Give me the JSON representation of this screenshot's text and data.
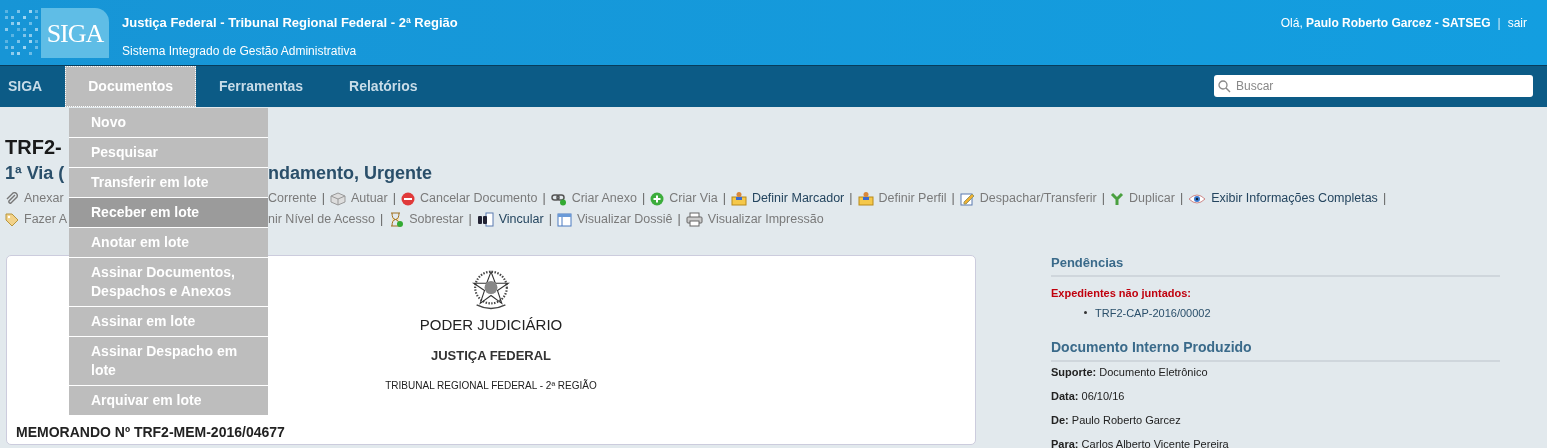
{
  "header": {
    "logo_text": "SIGA",
    "title": "Justiça Federal - Tribunal Regional Federal - 2ª Região",
    "subtitle": "Sistema Integrado de Gestão Administrativa",
    "greeting": "Olá,",
    "user": "Paulo Roberto Garcez - SATSEG",
    "separator": "|",
    "logout": "sair"
  },
  "nav": {
    "items": [
      {
        "label": "SIGA",
        "selected": false
      },
      {
        "label": "Documentos",
        "selected": true
      },
      {
        "label": "Ferramentas",
        "selected": false
      },
      {
        "label": "Relatórios",
        "selected": false
      }
    ],
    "search": {
      "placeholder": "Buscar"
    }
  },
  "menu": [
    {
      "label": "Novo",
      "selected": false
    },
    {
      "label": "Pesquisar",
      "selected": false
    },
    {
      "label": "Transferir em lote",
      "selected": false
    },
    {
      "label": "Receber em lote",
      "selected": true
    },
    {
      "label": "Anotar em lote",
      "selected": false
    },
    {
      "label": "Assinar Documentos, Despachos e Anexos",
      "selected": false
    },
    {
      "label": "Assinar em lote",
      "selected": false
    },
    {
      "label": "Assinar Despacho em lote",
      "selected": false
    },
    {
      "label": "Arquivar em lote",
      "selected": false
    }
  ],
  "document": {
    "heading": "TRF2-",
    "subtitle_left": "1ª Via (",
    "subtitle_right": "ndamento, Urgente",
    "action_rows": [
      {
        "left": {
          "label": "Anexar",
          "kind": "clip",
          "disabled": true
        },
        "items": [
          {
            "label": "Corrente",
            "kind": "none",
            "disabled": true,
            "separator": "|"
          },
          {
            "label": "Autuar",
            "kind": "cube",
            "disabled": true,
            "separator": "|"
          },
          {
            "label": "Cancelar Documento",
            "kind": "cancel",
            "disabled": true,
            "separator": "|"
          },
          {
            "label": "Criar Anexo",
            "kind": "link",
            "disabled": true,
            "separator": "|"
          },
          {
            "label": "Criar Via",
            "kind": "plus",
            "disabled": true,
            "separator": "|"
          },
          {
            "label": "Definir Marcador",
            "kind": "folder",
            "disabled": false,
            "separator": "|"
          },
          {
            "label": "Definir Perfil",
            "kind": "folder",
            "disabled": true,
            "separator": "|"
          },
          {
            "label": "Despachar/Transferir",
            "kind": "edit",
            "disabled": true,
            "separator": "|"
          },
          {
            "label": "Duplicar",
            "kind": "fork",
            "disabled": true,
            "separator": "|"
          },
          {
            "label": "Exibir Informações Completas",
            "kind": "eye",
            "disabled": false,
            "separator": "|"
          }
        ]
      },
      {
        "left": {
          "label": "Fazer A",
          "kind": "tag",
          "disabled": true
        },
        "items": [
          {
            "label": "nir Nível de Acesso",
            "kind": "none",
            "disabled": true,
            "separator": "|"
          },
          {
            "label": "Sobrestar",
            "kind": "hourglass",
            "disabled": true,
            "separator": "|"
          },
          {
            "label": "Vincular",
            "kind": "binoculars",
            "disabled": false,
            "separator": "|"
          },
          {
            "label": "Visualizar Dossiê",
            "kind": "window",
            "disabled": true,
            "separator": "|"
          },
          {
            "label": "Visualizar Impressão",
            "kind": "printer",
            "disabled": true
          }
        ]
      }
    ],
    "card": {
      "lines": [
        "PODER JUDICIÁRIO",
        "JUSTIÇA FEDERAL",
        "TRIBUNAL REGIONAL FEDERAL - 2ª REGIÃO"
      ],
      "memo": "MEMORANDO Nº TRF2-MEM-2016/04677"
    }
  },
  "sidebar": {
    "pending": {
      "title": "Pendências",
      "label": "Expedientes não juntados:",
      "items": [
        "TRF2-CAP-2016/00002"
      ]
    },
    "info": {
      "title": "Documento Interno Produzido",
      "fields": [
        {
          "label": "Suporte:",
          "value": "Documento Eletrônico"
        },
        {
          "label": "Data:",
          "value": "06/10/16"
        },
        {
          "label": "De:",
          "value": "Paulo Roberto Garcez"
        },
        {
          "label": "Para:",
          "value": "Carlos Alberto Vicente Pereira"
        }
      ]
    }
  }
}
